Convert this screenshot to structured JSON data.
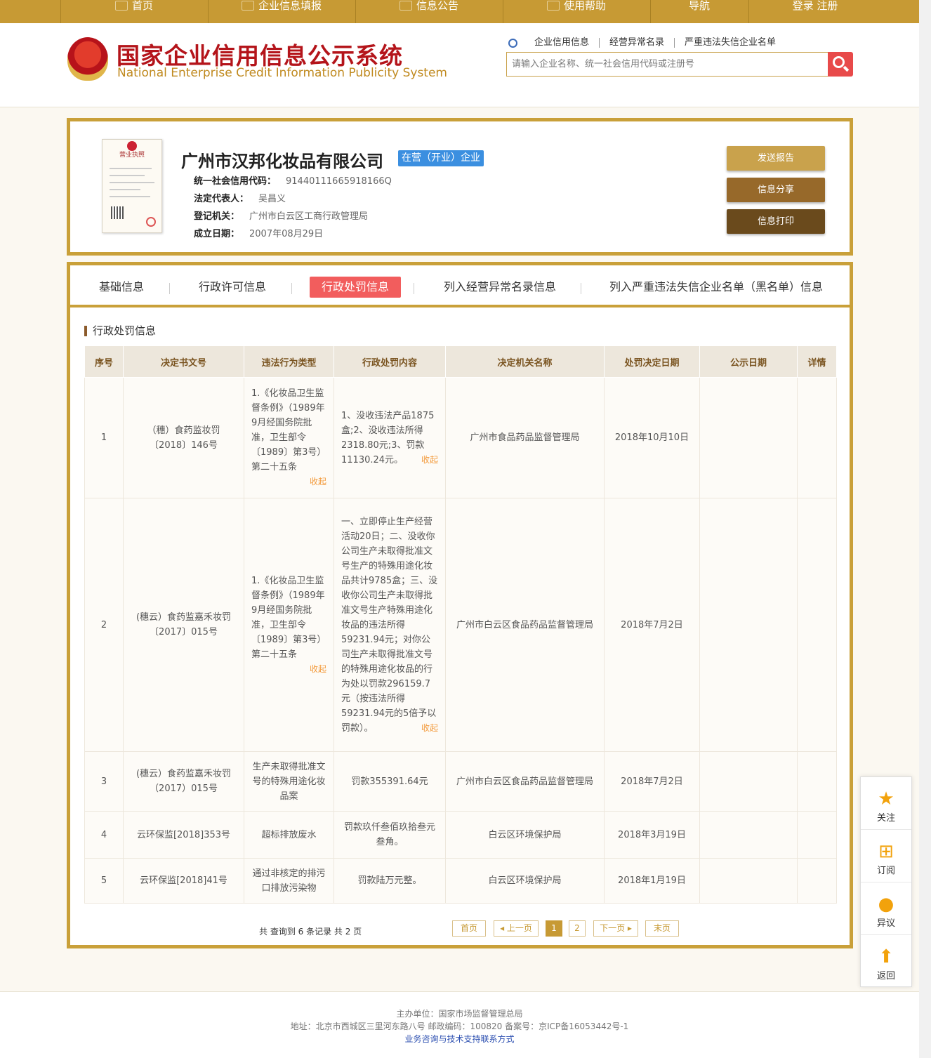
{
  "nav": {
    "items": [
      {
        "label": "首页",
        "icon": "monitor-icon"
      },
      {
        "label": "企业信息填报",
        "icon": "pen-icon"
      },
      {
        "label": "信息公告",
        "icon": "document-icon"
      },
      {
        "label": "使用帮助",
        "icon": "speaker-icon"
      },
      {
        "label": "导航"
      },
      {
        "label": "登录  注册"
      }
    ]
  },
  "header": {
    "title_cn": "国家企业信用信息公示系统",
    "title_en": "National Enterprise Credit Information Publicity System",
    "search_links": [
      "企业信用信息",
      "经营异常名录",
      "严重违法失信企业名单"
    ],
    "search_placeholder": "请输入企业名称、统一社会信用代码或注册号"
  },
  "company": {
    "license_title": "营业执照",
    "name": "广州市汉邦化妆品有限公司",
    "status": "在营（开业）企业",
    "fields": [
      {
        "label": "统一社会信用代码：",
        "value": "91440111665918166Q"
      },
      {
        "label": "法定代表人：",
        "value": "吴昌义"
      },
      {
        "label": "登记机关：",
        "value": "广州市白云区工商行政管理局"
      },
      {
        "label": "成立日期：",
        "value": "2007年08月29日"
      }
    ],
    "actions": [
      "发送报告",
      "信息分享",
      "信息打印"
    ]
  },
  "tabs": [
    "基础信息",
    "行政许可信息",
    "行政处罚信息",
    "列入经营异常名录信息",
    "列入严重违法失信企业名单（黑名单）信息"
  ],
  "active_tab": 2,
  "section_title": "行政处罚信息",
  "table": {
    "headers": [
      "序号",
      "决定书文号",
      "违法行为类型",
      "行政处罚内容",
      "决定机关名称",
      "处罚决定日期",
      "公示日期",
      "详情"
    ],
    "fold_label": "收起",
    "rows": [
      {
        "no": "1",
        "doc": "（穗）食药监妆罚〔2018〕146号",
        "type": "1.《化妆品卫生监督条例》（1989年9月经国务院批准，卫生部令〔1989〕第3号）第二十五条",
        "content": "1、没收违法产品1875盒;2、没收违法所得2318.80元;3、罚款11130.24元。",
        "authority": "广州市食品药品监督管理局",
        "date": "2018年10月10日",
        "publish": "",
        "detail": ""
      },
      {
        "no": "2",
        "doc": "(穗云）食药监嘉禾妆罚〔2017〕015号",
        "type": "1.《化妆品卫生监督条例》（1989年9月经国务院批准，卫生部令〔1989〕第3号）第二十五条",
        "content": "一、立即停止生产经营活动20日；二、没收你公司生产未取得批准文号生产的特殊用途化妆品共计9785盒；三、没收你公司生产未取得批准文号生产特殊用途化妆品的违法所得59231.94元；对你公司生产未取得批准文号的特殊用途化妆品的行为处以罚款296159.7元（按违法所得59231.94元的5倍予以罚款）。",
        "authority": "广州市白云区食品药品监督管理局",
        "date": "2018年7月2日",
        "publish": "",
        "detail": ""
      },
      {
        "no": "3",
        "doc": "(穗云）食药监嘉禾妆罚（2017）015号",
        "type": "生产未取得批准文号的特殊用途化妆品案",
        "content": "罚款355391.64元",
        "authority": "广州市白云区食品药品监督管理局",
        "date": "2018年7月2日",
        "publish": "",
        "detail": ""
      },
      {
        "no": "4",
        "doc": "云环保监[2018]353号",
        "type": "超标排放废水",
        "content": "罚款玖仟叁佰玖拾叁元叁角。",
        "authority": "白云区环境保护局",
        "date": "2018年3月19日",
        "publish": "",
        "detail": ""
      },
      {
        "no": "5",
        "doc": "云环保监[2018]41号",
        "type": "通过非核定的排污口排放污染物",
        "content": "罚款陆万元整。",
        "authority": "白云区环境保护局",
        "date": "2018年1月19日",
        "publish": "",
        "detail": ""
      }
    ]
  },
  "pager": {
    "summary": "共 查询到 6 条记录 共 2 页",
    "first": "首页",
    "prev": "上一页",
    "pages": [
      "1",
      "2"
    ],
    "current": "1",
    "next": "下一页",
    "last": "末页"
  },
  "side": [
    "关注",
    "订阅",
    "异议",
    "返回"
  ],
  "footer": {
    "host": "主办单位：国家市场监督管理总局",
    "address": "地址：北京市西城区三里河东路八号   邮政编码：100820   备案号：京ICP备16053442号-1",
    "contact": "业务咨询与技术支持联系方式"
  },
  "colors": {
    "gold": "#c79a34",
    "red": "#b4141a",
    "active_tab": "#f25d5d",
    "status": "#3b8fe0"
  }
}
